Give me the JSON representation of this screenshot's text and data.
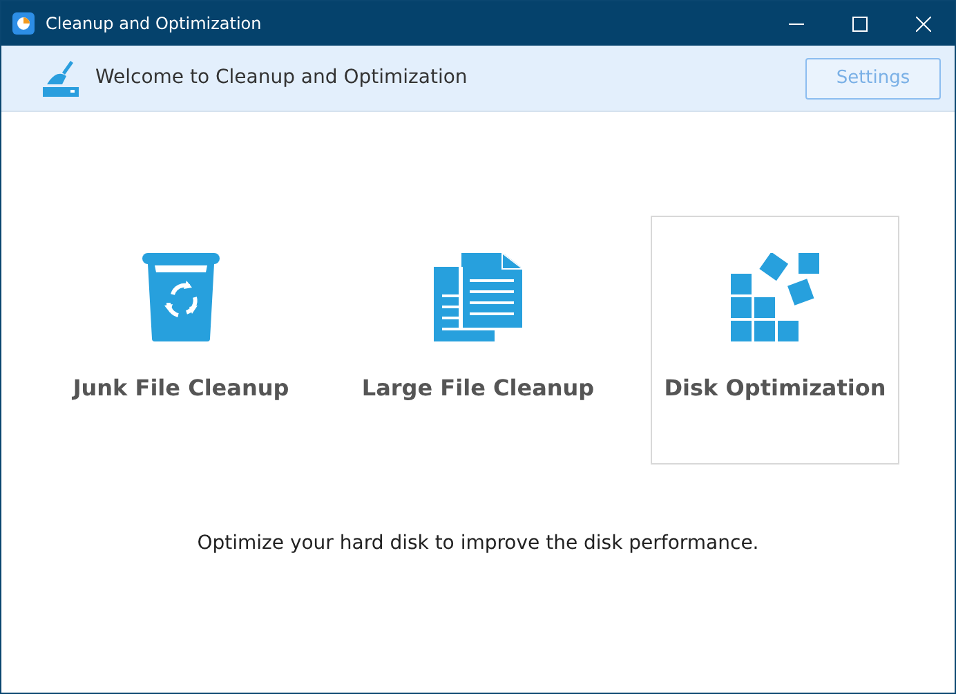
{
  "window": {
    "title": "Cleanup and Optimization"
  },
  "header": {
    "welcome": "Welcome to Cleanup and Optimization",
    "settings": {
      "label": "Settings",
      "disabled": true
    }
  },
  "tools": [
    {
      "kind": "junk",
      "label": "Junk File Cleanup",
      "selected": false
    },
    {
      "kind": "large",
      "label": "Large File Cleanup",
      "selected": false
    },
    {
      "kind": "disk",
      "label": "Disk Optimization",
      "selected": true
    }
  ],
  "description": "Optimize your hard disk to improve the disk performance."
}
